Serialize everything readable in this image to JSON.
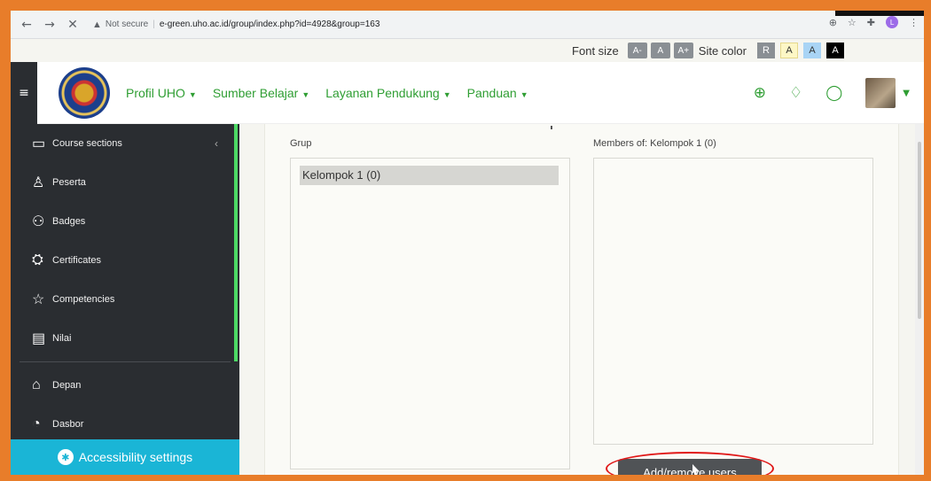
{
  "browser": {
    "back_icon": "arrow-left-icon",
    "forward_icon": "arrow-right-icon",
    "stop_icon": "close-icon",
    "security_text": "Not secure",
    "url": "e-green.uho.ac.id/group/index.php?id=4928&group=163",
    "profile_letter": "L"
  },
  "accessibility_bar": {
    "font_size_label": "Font size",
    "font_buttons": [
      "A-",
      "A",
      "A+"
    ],
    "site_color_label": "Site color",
    "color_buttons": [
      "R",
      "A",
      "A",
      "A"
    ]
  },
  "navbar": {
    "menu": [
      {
        "label": "Profil UHO"
      },
      {
        "label": "Sumber Belajar"
      },
      {
        "label": "Layanan Pendukung"
      },
      {
        "label": "Panduan"
      }
    ]
  },
  "sidebar": {
    "items": [
      {
        "label": "Course sections",
        "icon": "folder-icon"
      },
      {
        "label": "Peserta",
        "icon": "users-icon"
      },
      {
        "label": "Badges",
        "icon": "badge-icon"
      },
      {
        "label": "Certificates",
        "icon": "certificate-icon"
      },
      {
        "label": "Competencies",
        "icon": "star-icon"
      },
      {
        "label": "Nilai",
        "icon": "gradebook-icon"
      }
    ],
    "items2": [
      {
        "label": "Depan",
        "icon": "home-icon"
      },
      {
        "label": "Dasbor",
        "icon": "dashboard-icon"
      }
    ],
    "accessibility_settings": "Accessibility settings"
  },
  "groups": {
    "grup_label": "Grup",
    "members_label": "Members of: Kelompok 1 (0)",
    "group_options": [
      "Kelompok 1 (0)"
    ],
    "add_remove_button": "Add/remove users"
  },
  "colors": {
    "accent_green": "#2f9e33",
    "sidebar_bg": "#2a2d31",
    "accessibility_bg": "#1ab5d6",
    "highlight": "#e01818"
  }
}
